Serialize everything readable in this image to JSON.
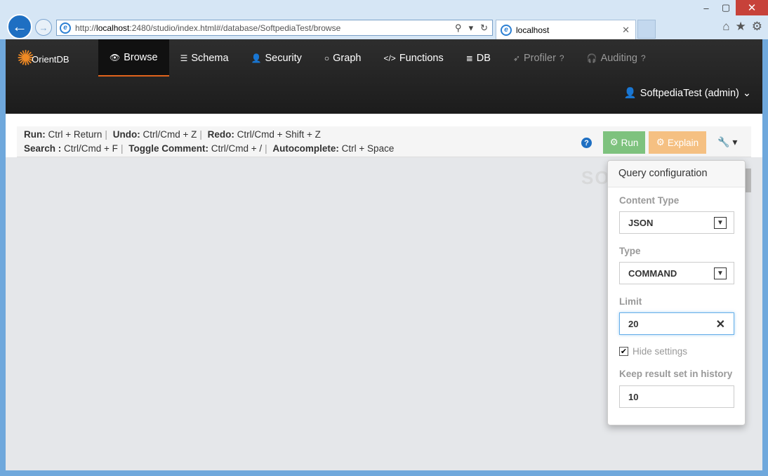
{
  "window": {
    "minimize": "‒",
    "restore": "▢",
    "close": "✕"
  },
  "browser": {
    "url_prefix": "http://",
    "url_host": "localhost",
    "url_rest": ":2480/studio/index.html#/database/SoftpediaTest/browse",
    "tab_title": "localhost",
    "icons": [
      "home-icon",
      "star-icon",
      "gear-icon"
    ]
  },
  "app": {
    "logo_text": "Orient",
    "logo_suffix": "DB",
    "nav": [
      {
        "label": "Browse",
        "icon": "eye-icon"
      },
      {
        "label": "Schema",
        "icon": "list-icon"
      },
      {
        "label": "Security",
        "icon": "user-icon"
      },
      {
        "label": "Graph",
        "icon": "circle-icon"
      },
      {
        "label": "Functions",
        "icon": "code-icon"
      },
      {
        "label": "DB",
        "icon": "database-icon"
      },
      {
        "label": "Profiler",
        "icon": "rocket-icon"
      },
      {
        "label": "Auditing",
        "icon": "headphones-icon"
      }
    ],
    "user": "SoftpediaTest (admin)"
  },
  "shortcuts": {
    "run_label": "Run:",
    "run_keys": "Ctrl + Return",
    "undo_label": "Undo:",
    "undo_keys": "Ctrl/Cmd + Z",
    "redo_label": "Redo:",
    "redo_keys": "Ctrl/Cmd + Shift + Z",
    "search_label": "Search :",
    "search_keys": "Ctrl/Cmd + F",
    "toggle_label": "Toggle Comment:",
    "toggle_keys": "Ctrl/Cmd + /",
    "auto_label": "Autocomplete:",
    "auto_keys": "Ctrl + Space"
  },
  "toolbar": {
    "run": "Run",
    "explain": "Explain"
  },
  "query_config": {
    "title": "Query configuration",
    "content_type_label": "Content Type",
    "content_type_value": "JSON",
    "type_label": "Type",
    "type_value": "COMMAND",
    "limit_label": "Limit",
    "limit_value": "20",
    "hide_settings_label": "Hide settings",
    "hide_settings_checked": true,
    "history_label": "Keep result set in history",
    "history_value": "10"
  },
  "watermark": "SOFTPEDIA"
}
